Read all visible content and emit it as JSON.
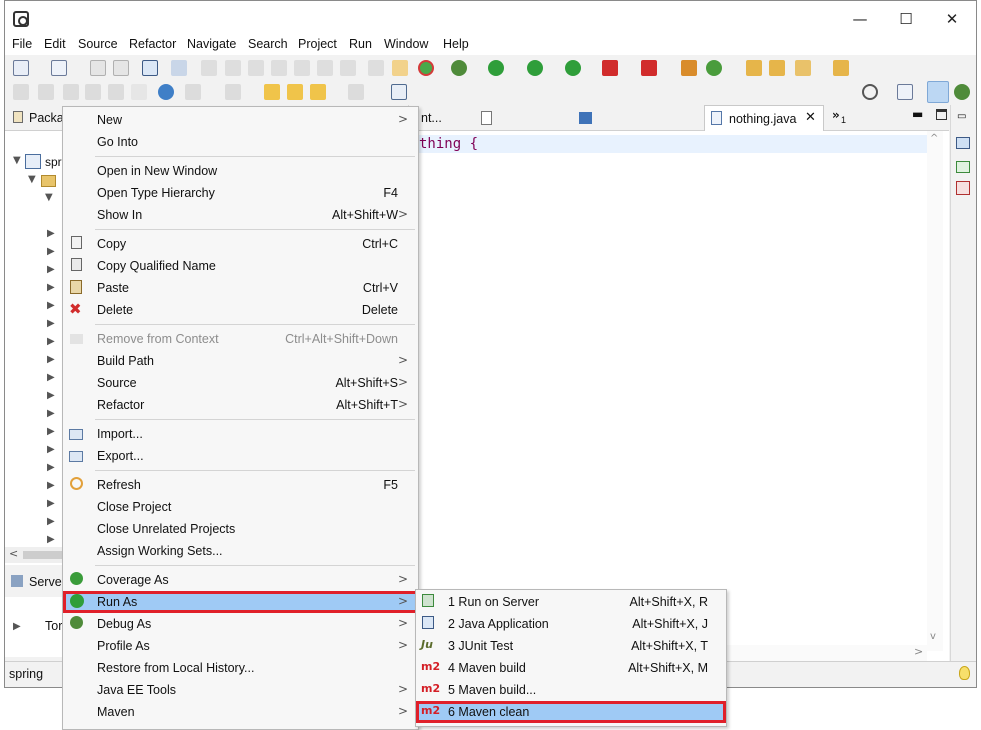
{
  "window": {
    "minimize": "—",
    "maximize": "☐",
    "close": "✕"
  },
  "menubar": [
    "File",
    "Edit",
    "Source",
    "Refactor",
    "Navigate",
    "Search",
    "Project",
    "Run",
    "Window",
    "Help"
  ],
  "left_panel": {
    "tab_label": "Packa",
    "project_label": "spr",
    "servers_tab": "Server",
    "tomcat_label": "Tor",
    "status_text": "spring"
  },
  "editor": {
    "tab_partial": "nt...",
    "active_tab": "nothing.java",
    "overflow_count": "1",
    "code_visible": "thing {"
  },
  "context_menu": {
    "items": [
      {
        "label": "New",
        "shortcut": "",
        "submenu": true
      },
      {
        "label": "Go Into",
        "shortcut": "",
        "submenu": false
      },
      {
        "label": "Open in New Window",
        "shortcut": "",
        "submenu": false
      },
      {
        "label": "Open Type Hierarchy",
        "shortcut": "F4",
        "submenu": false
      },
      {
        "label": "Show In",
        "shortcut": "Alt+Shift+W",
        "submenu": true
      },
      {
        "label": "Copy",
        "shortcut": "Ctrl+C",
        "submenu": false
      },
      {
        "label": "Copy Qualified Name",
        "shortcut": "",
        "submenu": false
      },
      {
        "label": "Paste",
        "shortcut": "Ctrl+V",
        "submenu": false
      },
      {
        "label": "Delete",
        "shortcut": "Delete",
        "submenu": false
      },
      {
        "label": "Remove from Context",
        "shortcut": "Ctrl+Alt+Shift+Down",
        "submenu": false,
        "disabled": true
      },
      {
        "label": "Build Path",
        "shortcut": "",
        "submenu": true
      },
      {
        "label": "Source",
        "shortcut": "Alt+Shift+S",
        "submenu": true
      },
      {
        "label": "Refactor",
        "shortcut": "Alt+Shift+T",
        "submenu": true
      },
      {
        "label": "Import...",
        "shortcut": "",
        "submenu": false
      },
      {
        "label": "Export...",
        "shortcut": "",
        "submenu": false
      },
      {
        "label": "Refresh",
        "shortcut": "F5",
        "submenu": false
      },
      {
        "label": "Close Project",
        "shortcut": "",
        "submenu": false
      },
      {
        "label": "Close Unrelated Projects",
        "shortcut": "",
        "submenu": false
      },
      {
        "label": "Assign Working Sets...",
        "shortcut": "",
        "submenu": false
      },
      {
        "label": "Coverage As",
        "shortcut": "",
        "submenu": true
      },
      {
        "label": "Run As",
        "shortcut": "",
        "submenu": true,
        "highlighted": true
      },
      {
        "label": "Debug As",
        "shortcut": "",
        "submenu": true
      },
      {
        "label": "Profile As",
        "shortcut": "",
        "submenu": true
      },
      {
        "label": "Restore from Local History...",
        "shortcut": "",
        "submenu": false
      },
      {
        "label": "Java EE Tools",
        "shortcut": "",
        "submenu": true
      },
      {
        "label": "Maven",
        "shortcut": "",
        "submenu": true
      }
    ]
  },
  "run_as_submenu": {
    "items": [
      {
        "label": "1 Run on Server",
        "shortcut": "Alt+Shift+X, R",
        "icon": "server-run-icon"
      },
      {
        "label": "2 Java Application",
        "shortcut": "Alt+Shift+X, J",
        "icon": "java-app-icon"
      },
      {
        "label": "3 JUnit Test",
        "shortcut": "Alt+Shift+X, T",
        "icon": "junit-icon"
      },
      {
        "label": "4 Maven build",
        "shortcut": "Alt+Shift+X, M",
        "icon": "m2-icon"
      },
      {
        "label": "5 Maven build...",
        "shortcut": "",
        "icon": "m2-icon"
      },
      {
        "label": "6 Maven clean",
        "shortcut": "",
        "icon": "m2-icon",
        "highlighted": true
      }
    ],
    "m2_glyph": "m2",
    "junit_glyph": "Ju"
  },
  "colors": {
    "highlight_fill": "#9fcaf5",
    "highlight_outline": "#e0202a",
    "keyword": "#7f0055",
    "m2_red": "#d41f26"
  }
}
